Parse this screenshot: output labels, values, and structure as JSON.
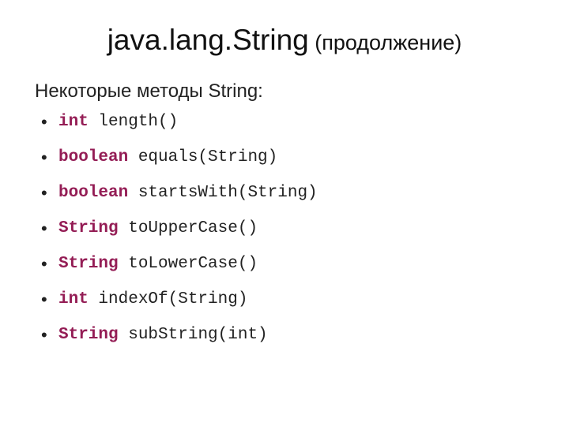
{
  "title": {
    "main": "java.lang.String",
    "sub": " (продолжение)"
  },
  "subtitle": "Некоторые методы String:",
  "methods": [
    {
      "kw": "int",
      "rest": " length()"
    },
    {
      "kw": "boolean",
      "rest": " equals(String)"
    },
    {
      "kw": "boolean",
      "rest": " startsWith(String)"
    },
    {
      "kw": "String",
      "rest": " toUpperCase()"
    },
    {
      "kw": "String",
      "rest": " toLowerCase()"
    },
    {
      "kw": "int",
      "rest": " indexOf(String)"
    },
    {
      "kw": "String",
      "rest": " subString(int)"
    }
  ]
}
